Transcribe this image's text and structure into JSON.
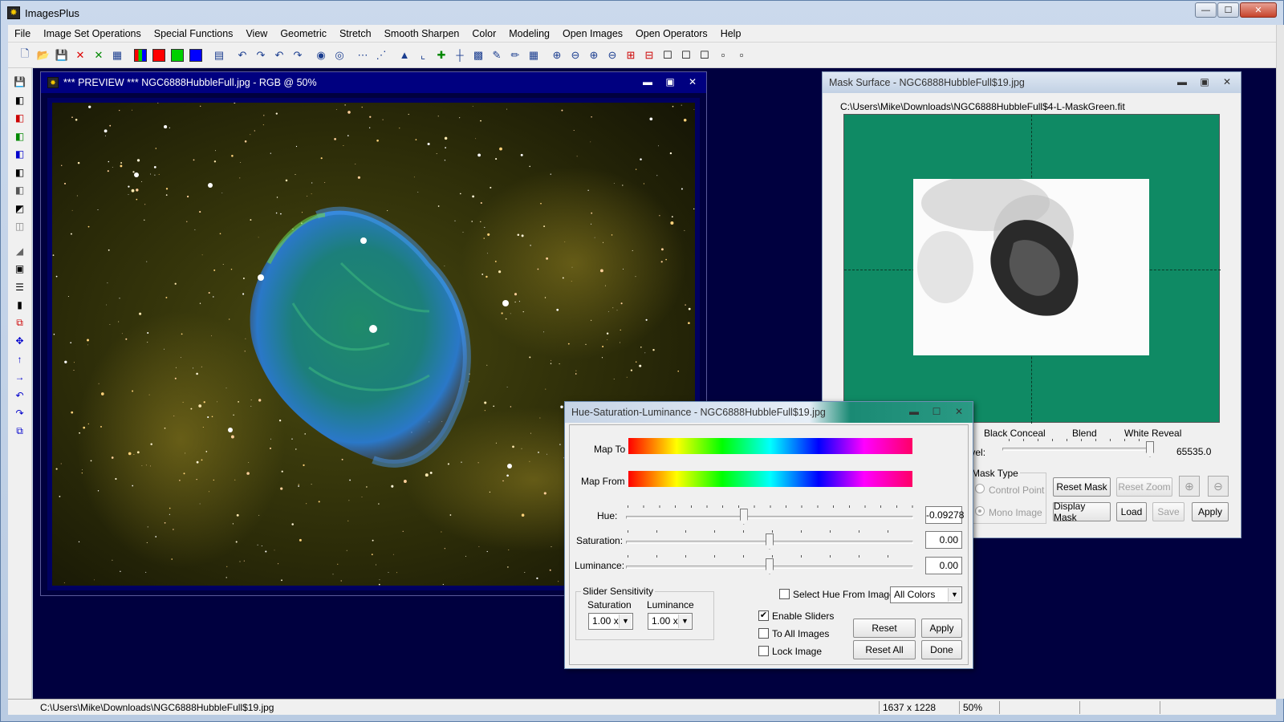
{
  "app": {
    "title": "ImagesPlus",
    "icon": "app-logo-icon",
    "caption_buttons": {
      "minimize": "—",
      "maximize": "☐",
      "close": "✕"
    }
  },
  "menu": [
    "File",
    "Image Set Operations",
    "Special Functions",
    "View",
    "Geometric",
    "Stretch",
    "Smooth Sharpen",
    "Color",
    "Modeling",
    "Open Images",
    "Open Operators",
    "Help"
  ],
  "toolbar": {
    "icons": [
      "new-file-icon",
      "open-folder-icon",
      "save-icon",
      "close-red-x-icon",
      "close-green-x-icon",
      "print-icon",
      "rgb-channels-icon",
      "red-channel-icon",
      "green-channel-icon",
      "blue-channel-icon",
      "stack-icon",
      "undo-icon",
      "redo-icon",
      "undo-all-icon",
      "redo-all-icon",
      "black-point-icon",
      "white-point-icon",
      "dotted-line-icon",
      "plot-icon",
      "histogram-icon",
      "curve-icon",
      "add-star-icon",
      "crosshair-icon",
      "grid-icon",
      "paint-icon",
      "pencil-icon",
      "frame-icon",
      "zoom-in-icon",
      "zoom-out-icon",
      "zoom-fit-icon",
      "zoom-actual-icon",
      "zoom-plus-icon",
      "zoom-minus-icon",
      "square-large-icon",
      "square-medium-icon",
      "square-small-icon",
      "square-tiny-icon",
      "square-point-icon"
    ],
    "colors": {
      "red": "#ff0000",
      "green": "#00d000",
      "blue": "#0000ff"
    }
  },
  "sidebar_icons": [
    "save-small-icon",
    "black-white-icon",
    "red-tool-icon",
    "green-tool-icon",
    "blue-tool-icon",
    "contrast-tool-icon",
    "gray-tool-icon",
    "shadow-tool-icon",
    "copy-tool-icon",
    "gradient-tool-icon",
    "select-tool-icon",
    "lines-tool-icon",
    "bar-tool-icon",
    "crop-tool-icon",
    "move-tool-icon",
    "arrow-up-icon",
    "arrow-right-icon",
    "rotate-left-icon",
    "rotate-right-icon",
    "flip-icon"
  ],
  "preview_window": {
    "title": "*** PREVIEW *** NGC6888HubbleFull.jpg - RGB @ 50%",
    "icon": "image-window-icon"
  },
  "mask_window": {
    "title": "Mask Surface - NGC6888HubbleFull$19.jpg",
    "path": "C:\\Users\\Mike\\Downloads\\NGC6888HubbleFull$4-L-MaskGreen.fit",
    "mask_bg": "#0f8a64",
    "blend_labels": {
      "black": "Black Conceal",
      "blend": "Blend",
      "white": "White Reveal"
    },
    "level_label": "Level:",
    "level_value": "65535.0",
    "level_fraction": 1.0,
    "mask_type": {
      "label": "Mask Type",
      "control_point": "Control Point",
      "mono_image": "Mono Image"
    },
    "buttons": {
      "reset_mask": "Reset Mask",
      "reset_zoom": "Reset Zoom",
      "display_mask": "Display Mask",
      "load": "Load",
      "save": "Save",
      "apply": "Apply"
    }
  },
  "hsl_dialog": {
    "title": "Hue-Saturation-Luminance - NGC6888HubbleFull$19.jpg",
    "map_to": "Map To",
    "map_from": "Map From",
    "hue": {
      "label": "Hue:",
      "value": "-0.09278",
      "fraction": 0.41
    },
    "saturation": {
      "label": "Saturation:",
      "value": "0.00",
      "fraction": 0.5
    },
    "luminance": {
      "label": "Luminance:",
      "value": "0.00",
      "fraction": 0.5
    },
    "sensitivity": {
      "label": "Slider Sensitivity",
      "saturation_label": "Saturation",
      "luminance_label": "Luminance",
      "saturation_value": "1.00 x",
      "luminance_value": "1.00 x"
    },
    "select_hue": {
      "label": "Select Hue From Image",
      "checked": false
    },
    "color_select": "All Colors",
    "enable_sliders": {
      "label": "Enable Sliders",
      "checked": true
    },
    "to_all_images": {
      "label": "To All Images",
      "checked": false
    },
    "lock_image": {
      "label": "Lock Image",
      "checked": false
    },
    "buttons": {
      "reset": "Reset",
      "apply": "Apply",
      "reset_all": "Reset All",
      "done": "Done"
    },
    "check_mark": "✔"
  },
  "status": {
    "path": "C:\\Users\\Mike\\Downloads\\NGC6888HubbleFull$19.jpg",
    "dimensions": "1637 x 1228",
    "zoom": "50%"
  }
}
